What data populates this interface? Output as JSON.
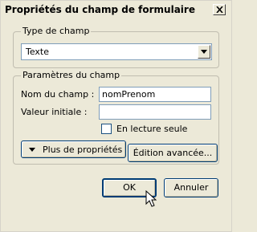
{
  "dialog": {
    "title": "Propriétés du champ de formulaire",
    "close_icon": "close-icon"
  },
  "field_type": {
    "legend": "Type de champ",
    "selected": "Texte",
    "dropdown_icon": "chevron-down-icon"
  },
  "field_params": {
    "legend": "Paramètres du champ",
    "name_label": "Nom du champ :",
    "name_value": "nomPrenom",
    "initial_label": "Valeur initiale :",
    "initial_value": "",
    "readonly_label": "En lecture seule",
    "readonly_checked": false,
    "more_props_label": "Plus de propriétés",
    "more_props_icon": "triangle-down-icon"
  },
  "buttons": {
    "advanced_label": "Édition avancée...",
    "ok_label": "OK",
    "cancel_label": "Annuler"
  },
  "colors": {
    "dialog_background": "#ece9d8",
    "button_border": "#003c74",
    "input_border": "#7f9db9"
  }
}
